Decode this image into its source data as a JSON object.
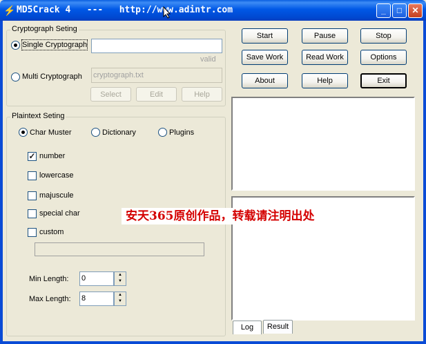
{
  "window": {
    "title": "MD5Crack 4   ---   http://www.adintr.com",
    "minimize_glyph": "_",
    "maximize_glyph": "□",
    "close_glyph": "✕"
  },
  "cryptograph_group": {
    "label": "Cryptograph Seting",
    "single_label": "Single Cryptograph",
    "single_value": "",
    "valid_text": "valid",
    "multi_label": "Multi Cryptograph",
    "multi_file": "cryptograph.txt",
    "select_label": "Select",
    "edit_label": "Edit",
    "help_label": "Help"
  },
  "plaintext_group": {
    "label": "Plaintext Seting",
    "mode_char_muster": "Char Muster",
    "mode_dictionary": "Dictionary",
    "mode_plugins": "Plugins",
    "opt_number": "number",
    "opt_lowercase": "lowercase",
    "opt_majuscule": "majuscule",
    "opt_special": "special char",
    "opt_custom": "custom",
    "custom_value": "",
    "check_mark": "✓",
    "min_label": "Min Length:",
    "min_value": "0",
    "max_label": "Max Length:",
    "max_value": "8",
    "spin_up": "▲",
    "spin_down": "▼"
  },
  "buttons": {
    "start": "Start",
    "pause": "Pause",
    "stop": "Stop",
    "save_work": "Save Work",
    "read_work": "Read Work",
    "options": "Options",
    "about": "About",
    "help": "Help",
    "exit": "Exit"
  },
  "tabs": {
    "log": "Log",
    "result": "Result"
  },
  "watermark": "安天365原创作品，转载请注明出处",
  "colors": {
    "titlebar": "#0054e3",
    "window_bg": "#ece9d8",
    "watermark": "#d40000"
  }
}
